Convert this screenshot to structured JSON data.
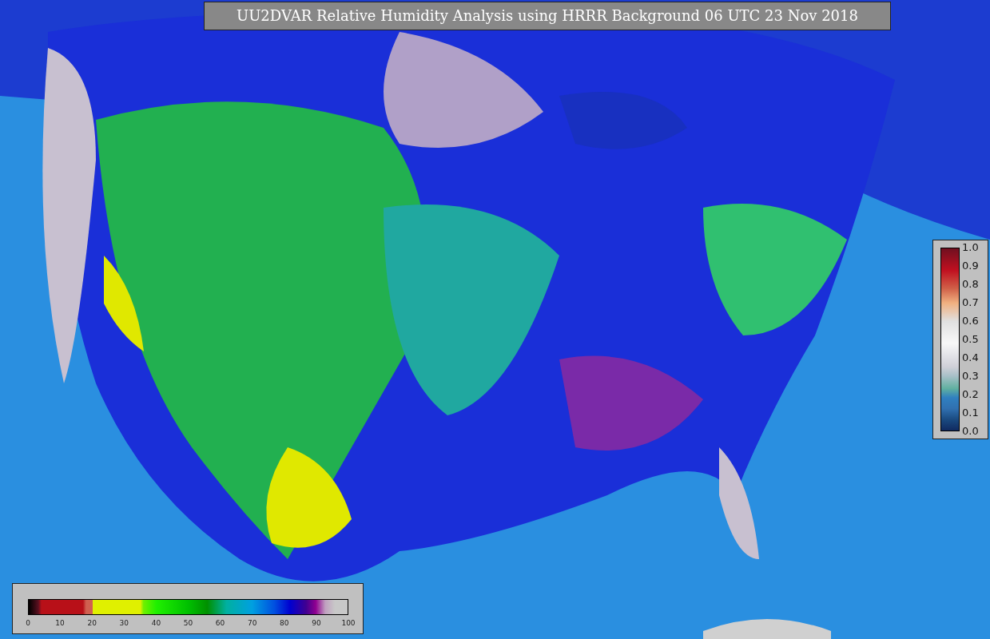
{
  "title": "UU2DVAR Relative Humidity Analysis using HRRR Background 06 UTC 23 Nov 2018",
  "humidity_colorbar": {
    "ticks": [
      "0",
      "10",
      "20",
      "30",
      "40",
      "50",
      "60",
      "70",
      "80",
      "90",
      "100"
    ]
  },
  "station_colorbar": {
    "ticks": [
      "1.0",
      "0.9",
      "0.8",
      "0.7",
      "0.6",
      "0.5",
      "0.4",
      "0.3",
      "0.2",
      "0.1",
      "0.0"
    ]
  }
}
